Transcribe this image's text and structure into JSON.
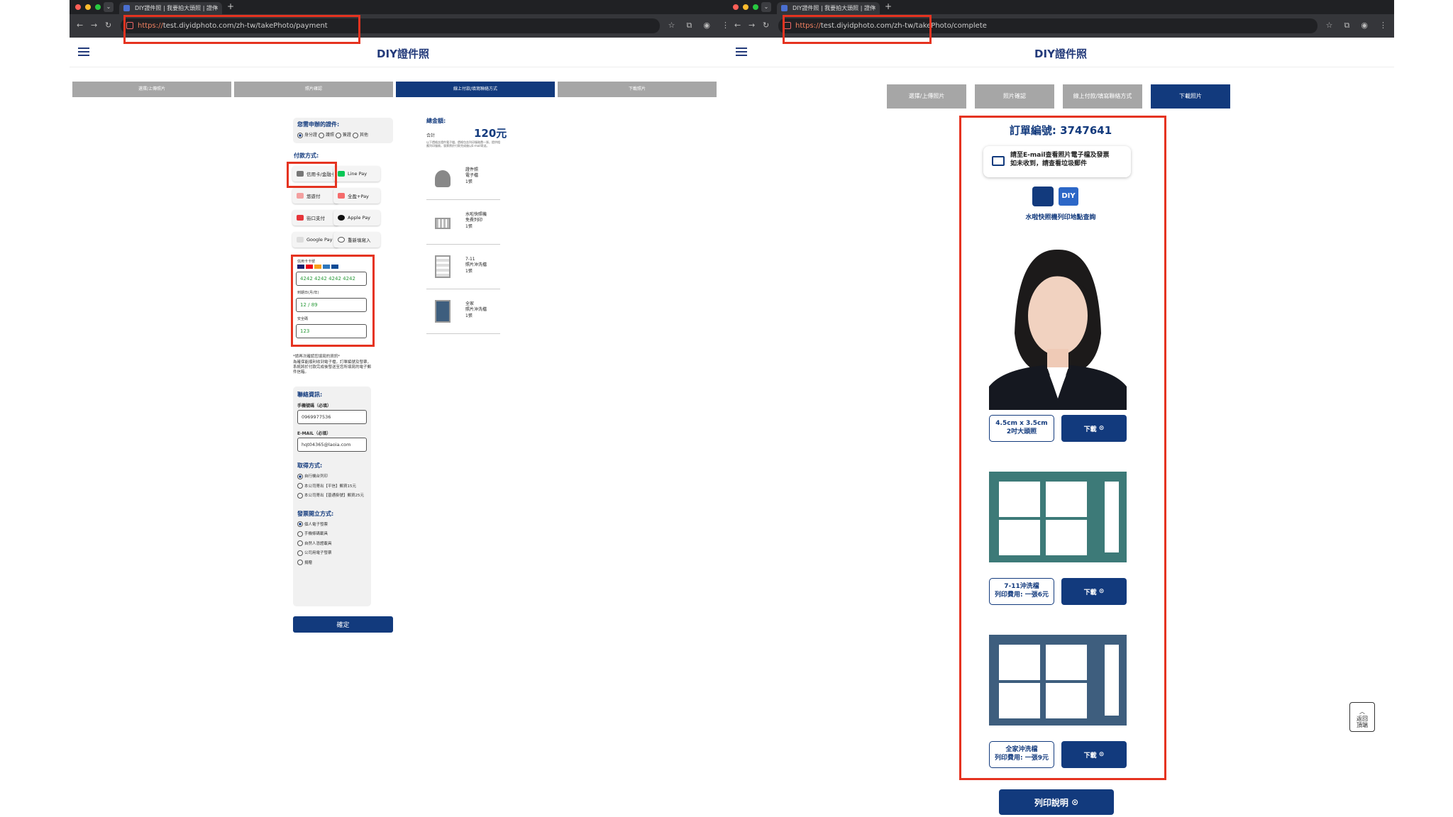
{
  "left": {
    "tab_title": "DIY證件照 | 我要拍大頭照 | 證件",
    "url_scheme": "https://",
    "url_rest": "test.diyidphoto.com/zh-tw/takePhoto/payment",
    "site_title": "DIY證件照",
    "steps": [
      "選擇/上傳照片",
      "照片確認",
      "線上付款/填寫聯絡方式",
      "下載照片"
    ],
    "doc_question": "您需申辦的證件:",
    "doc_options": [
      "身分證",
      "護照",
      "簽證",
      "其他"
    ],
    "pay_method_label": "付款方式:",
    "pay_buttons": [
      "信用卡/金融卡",
      "Line Pay",
      "悠遊付",
      "全盈+Pay",
      "街口支付",
      "Apple Pay",
      "Google Pay",
      "重新填寫入"
    ],
    "card_number_label": "信用卡卡號",
    "card_number": "4242 4242 4242 4242",
    "expiry_label": "到期日(月/年)",
    "expiry": "12 / 89",
    "cvc_label": "安全碼",
    "cvc": "123",
    "note_title": "*請再次確認您填寫的資訊*",
    "note_body": "為確保能順利收到電子檔，訂單編號及發票，系統將於付款完成後發送至您所填寫的電子郵件信箱。",
    "contact_label": "聯絡資訊:",
    "phone_label": "手機號碼（必填）",
    "phone": "0969977536",
    "email_label": "E-MAIL（必填）",
    "email": "hqt04365@laoia.com",
    "pickup_label": "取得方式:",
    "pickup_options": [
      "自行機台列印",
      "本公司寄出【平信】郵資15元",
      "本公司寄出【普通掛號】郵資25元"
    ],
    "invoice_label": "發票開立方式:",
    "invoice_options": [
      "個人電子發票",
      "手機條碼載具",
      "自然人憑證載具",
      "公司用電子發票",
      "捐贈"
    ],
    "confirm": "確定",
    "total_label": "總金額:",
    "total_value": "120元",
    "subtotal_label": "合計",
    "price_note": "以下價格含證件電子檔，價格包含列印服務費一張，提供相應列印服務，發票將於付款完成後以E-mail寄送。",
    "products": [
      {
        "name": "證件照",
        "sub": "電子檔",
        "qty": "1張"
      },
      {
        "name": "水啦快照機",
        "sub": "免費列印",
        "qty": "1張"
      },
      {
        "name": "7-11",
        "sub": "照片沖洗檔",
        "qty": "1張"
      },
      {
        "name": "全家",
        "sub": "照片沖洗檔",
        "qty": "1張"
      }
    ]
  },
  "right": {
    "tab_title": "DIY證件照 | 我要拍大頭照 | 證件",
    "url_scheme": "https://",
    "url_rest": "test.diyidphoto.com/zh-tw/takePhoto/complete",
    "site_title": "DIY證件照",
    "steps": [
      "選擇/上傳照片",
      "照片確認",
      "線上付款/填寫聯絡方式",
      "下載照片"
    ],
    "order_no": "訂單編號: 3747641",
    "mail_line1": "請至E-mail查看照片電子檔及發票",
    "mail_line2": "如未收到，請查看垃圾郵件",
    "diy_badge": "DIY",
    "kiosk_text": "水啦快照機列印地點查詢",
    "size_line1": "4.5cm x 3.5cm",
    "size_line2": "2吋大頭照",
    "download": "下載",
    "seven_line1": "7-11沖洗檔",
    "seven_line2": "列印費用: 一張6元",
    "family_line1": "全家沖洗檔",
    "family_line2": "列印費用: 一張9元",
    "print_guide": "列印說明",
    "back_top": "返回頂端"
  },
  "colors": {
    "brand": "#123a7d",
    "highlight": "#e53320",
    "teal": "#3d7a78",
    "slate": "#3e5e7e"
  }
}
